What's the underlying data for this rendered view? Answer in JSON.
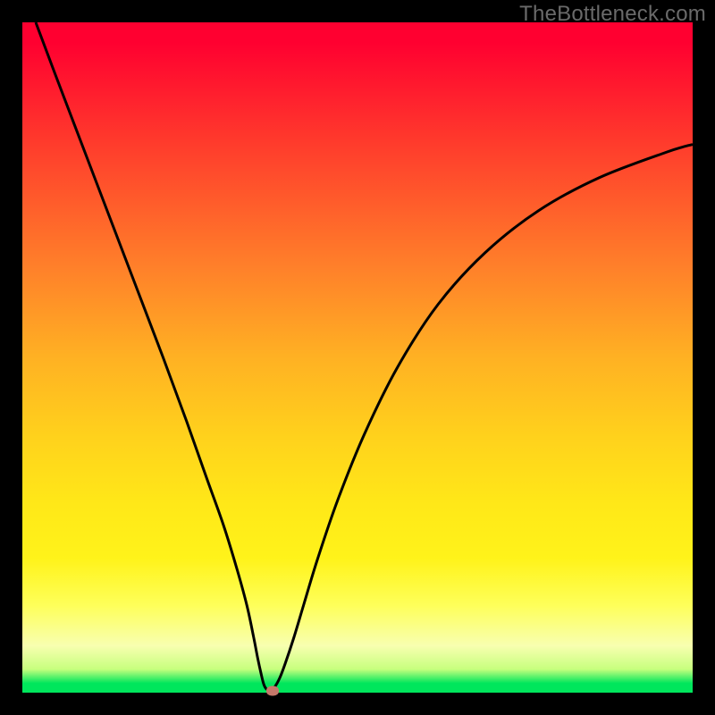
{
  "watermark": "TheBottleneck.com",
  "chart_data": {
    "type": "line",
    "title": "",
    "xlabel": "",
    "ylabel": "",
    "xlim": [
      0,
      100
    ],
    "ylim": [
      0,
      100
    ],
    "series": [
      {
        "name": "curve",
        "x": [
          2,
          5,
          9,
          13,
          17,
          21,
          24.5,
          27.5,
          30,
          32,
          33.5,
          34.5,
          35.1,
          35.6,
          36.0,
          36.4,
          36.9,
          37.6,
          38.4,
          39.2,
          40.5,
          42,
          44,
          47,
          51,
          56,
          62,
          69,
          77,
          86,
          96,
          100
        ],
        "y": [
          100,
          92,
          81.5,
          71,
          60.5,
          50,
          40.5,
          32,
          25,
          18.5,
          13,
          8.3,
          5.2,
          2.9,
          1.3,
          0.55,
          0.4,
          0.8,
          2.2,
          4.3,
          8.2,
          13.2,
          19.8,
          28.6,
          38.5,
          48.6,
          57.9,
          65.6,
          71.9,
          76.8,
          80.6,
          81.8
        ]
      }
    ],
    "marker": {
      "x": 37.3,
      "y": 0.3
    },
    "gradient_stops": [
      {
        "pct": 0,
        "color": "#ff0030"
      },
      {
        "pct": 50,
        "color": "#ffb123"
      },
      {
        "pct": 80,
        "color": "#fff31a"
      },
      {
        "pct": 98.6,
        "color": "#00e65c"
      }
    ]
  }
}
